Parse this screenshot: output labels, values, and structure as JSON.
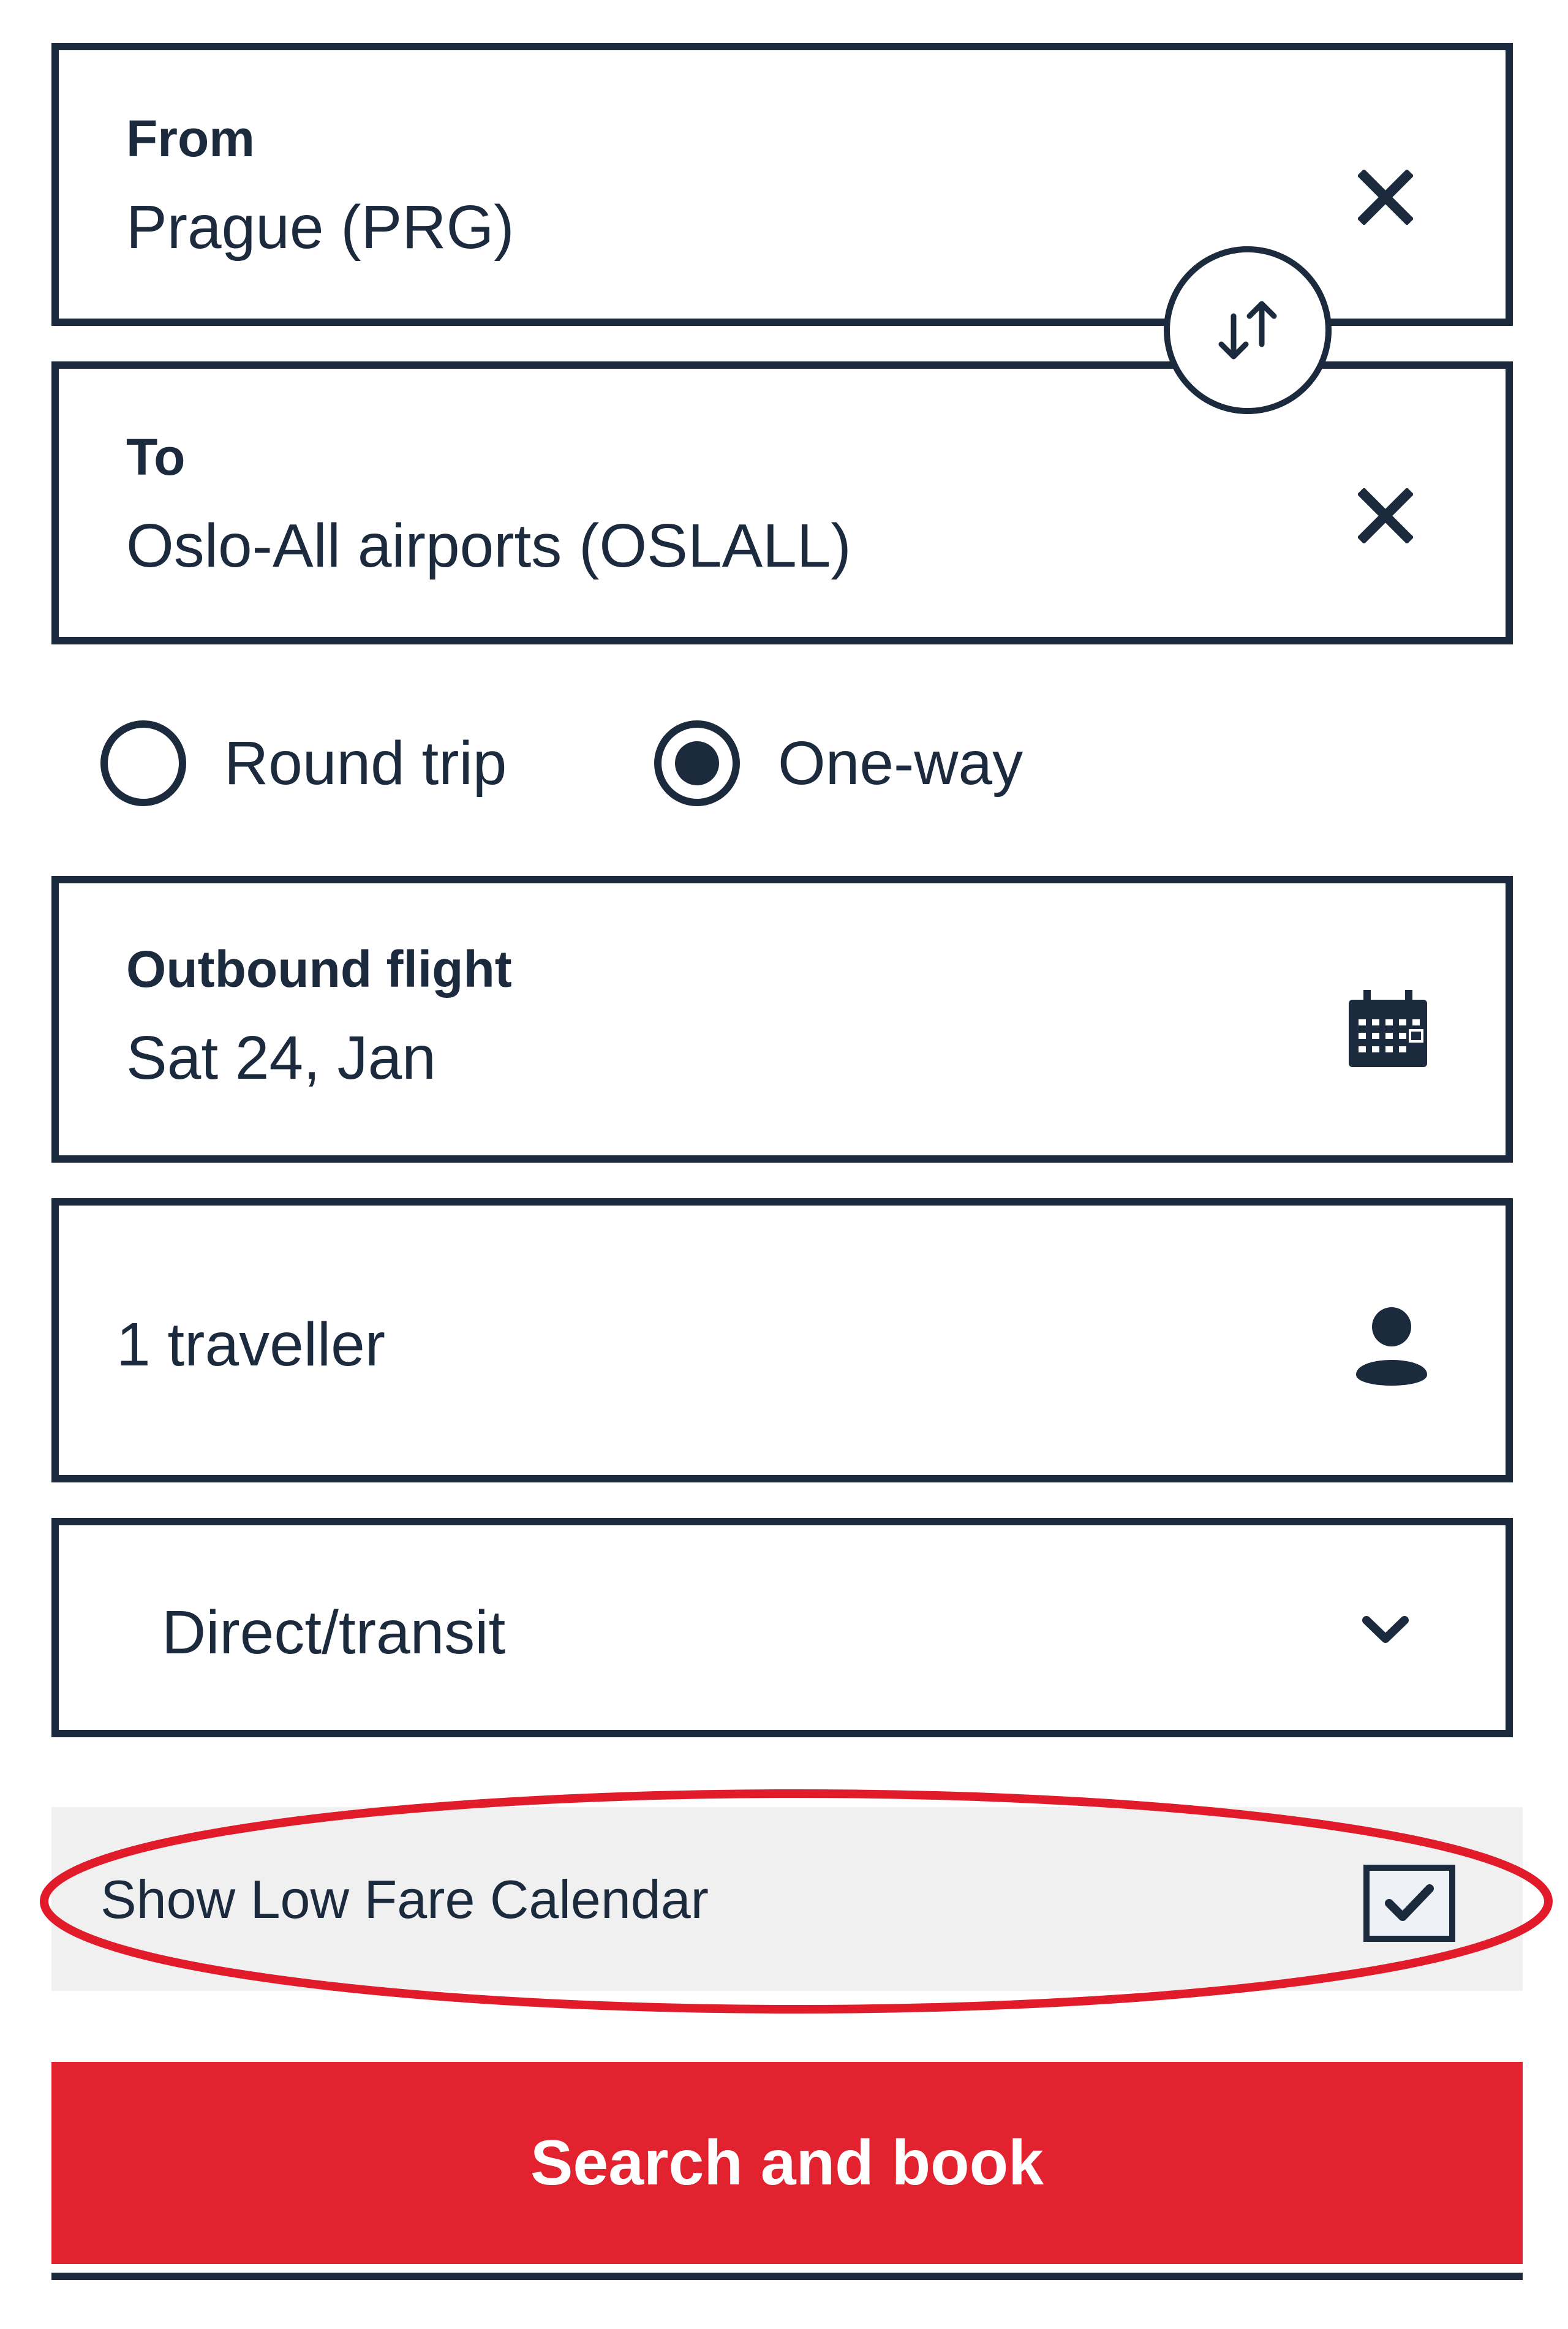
{
  "from": {
    "label": "From",
    "value": "Prague (PRG)",
    "clear_icon": "close-icon"
  },
  "swap": {
    "icon": "swap-arrows-icon"
  },
  "to": {
    "label": "To",
    "value": "Oslo-All airports (OSLALL)",
    "clear_icon": "close-icon"
  },
  "trip_type": {
    "options": [
      "Round trip",
      "One-way"
    ],
    "selected": "One-way"
  },
  "outbound": {
    "label": "Outbound flight",
    "value": "Sat 24, Jan",
    "icon": "calendar-icon"
  },
  "travellers": {
    "value": "1 traveller",
    "icon": "person-icon"
  },
  "stops": {
    "value": "Direct/transit",
    "icon": "chevron-down-icon"
  },
  "low_fare": {
    "label": "Show Low Fare Calendar",
    "checked": true,
    "icon": "checkmark-icon"
  },
  "search": {
    "label": "Search and book"
  },
  "colors": {
    "navy": "#1c2a3d",
    "brand_red": "#e3222f",
    "annotation_red": "#e11b2a",
    "row_grey": "#f0f0f0"
  }
}
